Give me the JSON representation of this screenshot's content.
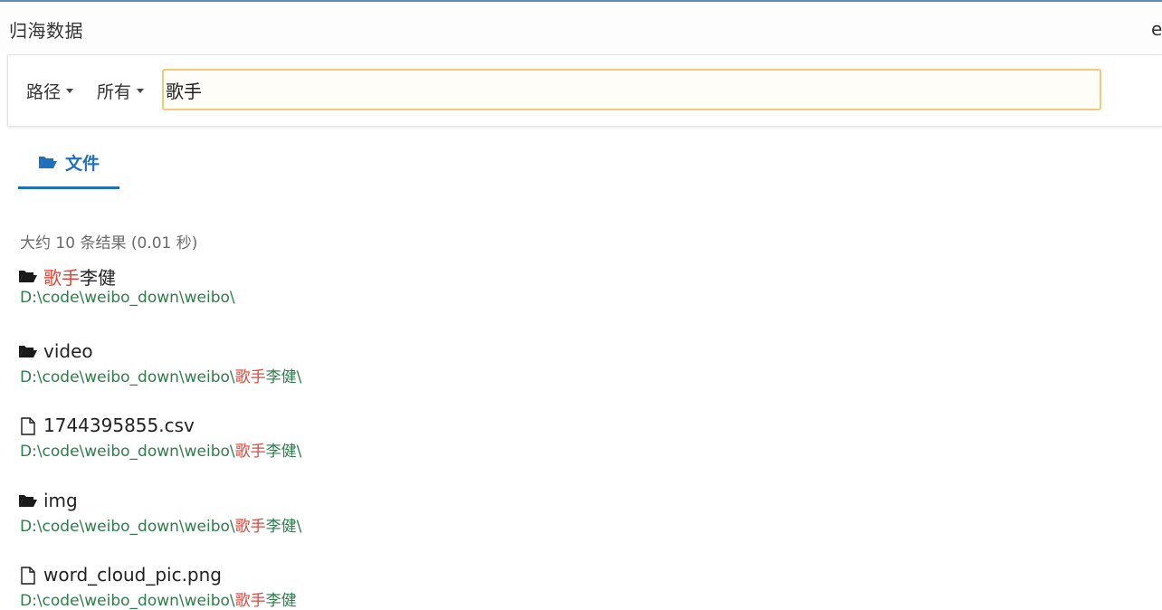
{
  "app": {
    "title": "归海数据",
    "right_glyph": "e"
  },
  "search": {
    "path_dropdown": "路径",
    "scope_dropdown": "所有",
    "query": "歌手",
    "placeholder": ""
  },
  "tabs": [
    {
      "label": "文件",
      "icon": "folder-open-icon",
      "active": true
    }
  ],
  "stats": "大约 10 条结果 (0.01 秒)",
  "results": [
    {
      "type": "folder",
      "icon": "folder-open-icon",
      "name_highlight": "歌手",
      "name_rest": "李健",
      "path_prefix": "D:\\code\\weibo_down\\weibo\\",
      "path_highlight": "",
      "path_suffix": ""
    },
    {
      "type": "folder",
      "icon": "folder-open-icon",
      "name_highlight": "",
      "name_rest": "video",
      "path_prefix": "D:\\code\\weibo_down\\weibo\\",
      "path_highlight": "歌手",
      "path_suffix": "李健\\"
    },
    {
      "type": "file",
      "icon": "file-icon",
      "name_highlight": "",
      "name_rest": "1744395855.csv",
      "path_prefix": "D:\\code\\weibo_down\\weibo\\",
      "path_highlight": "歌手",
      "path_suffix": "李健\\"
    },
    {
      "type": "folder",
      "icon": "folder-open-icon",
      "name_highlight": "",
      "name_rest": "img",
      "path_prefix": "D:\\code\\weibo_down\\weibo\\",
      "path_highlight": "歌手",
      "path_suffix": "李健\\"
    },
    {
      "type": "file",
      "icon": "file-icon",
      "name_highlight": "",
      "name_rest": "word_cloud_pic.png",
      "path_prefix": "D:\\code\\weibo_down\\weibo\\",
      "path_highlight": "歌手",
      "path_suffix": "李健"
    }
  ],
  "colors": {
    "accent": "#1f6fbf",
    "highlight": "#e0463a",
    "path": "#2e7d4a",
    "input_border": "#f2c97a"
  }
}
